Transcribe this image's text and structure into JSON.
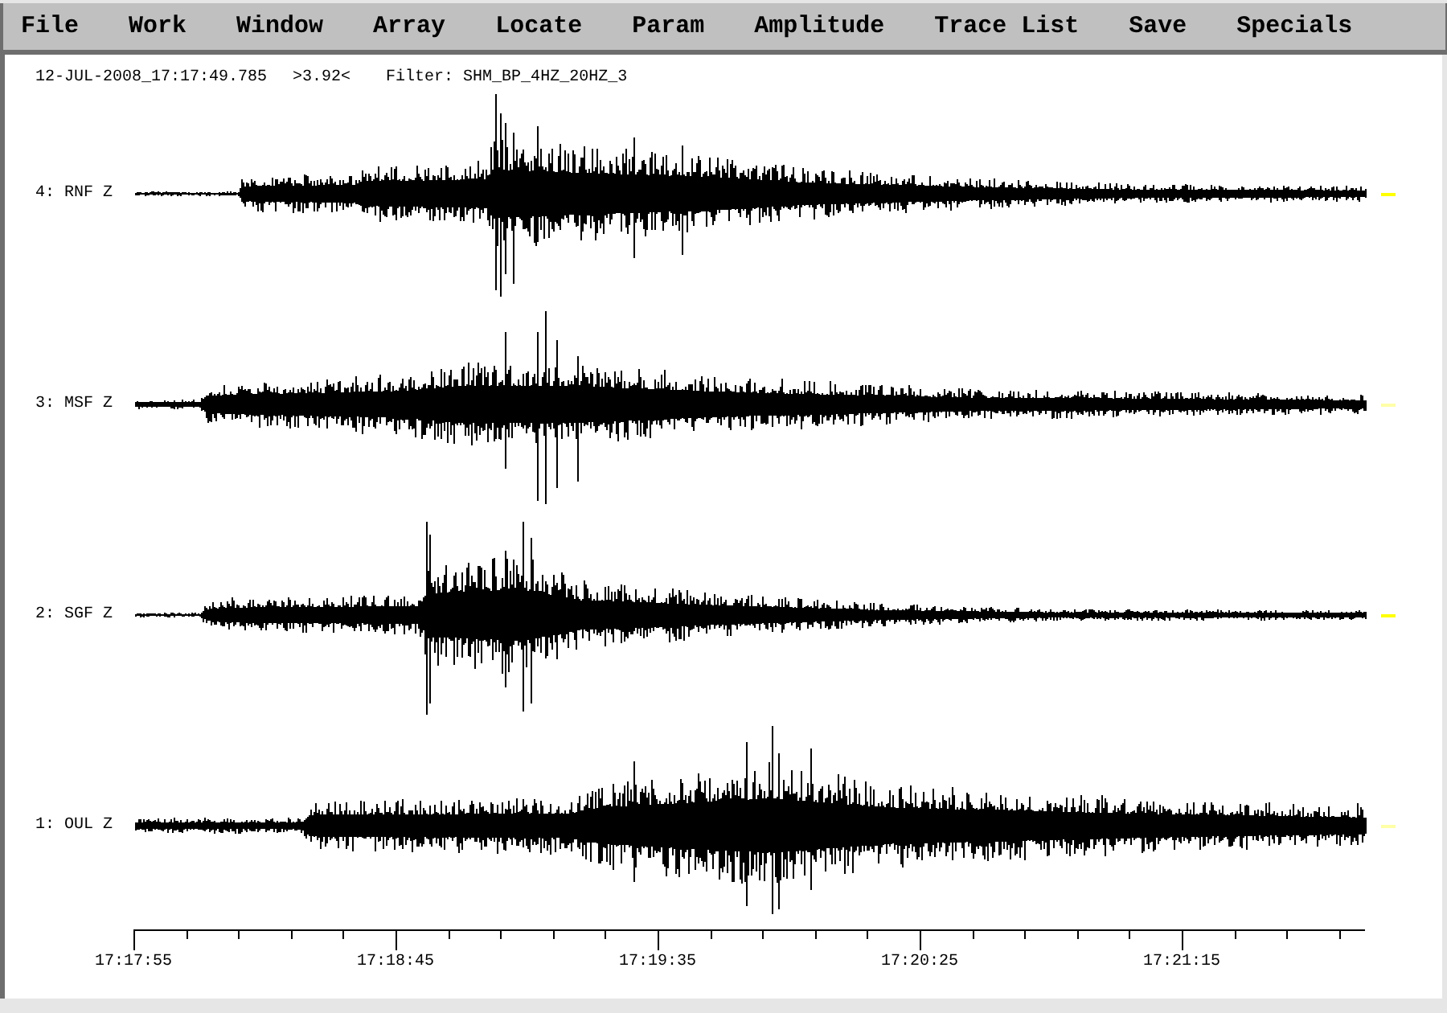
{
  "menu": [
    "File",
    "Work",
    "Window",
    "Array",
    "Locate",
    "Param",
    "Amplitude",
    "Trace List",
    "Save",
    "Specials"
  ],
  "header": {
    "timestamp": "12-JUL-2008_17:17:49.785",
    "amplitude_range": ">3.92<",
    "filter": "Filter: SHM_BP_4HZ_20HZ_3"
  },
  "traces": [
    {
      "label": "4: RNF Z",
      "color": "#ffff00"
    },
    {
      "label": "3: MSF Z",
      "color": "#ffffa8"
    },
    {
      "label": "2: SGF Z",
      "color": "#ffff00"
    },
    {
      "label": "1: OUL Z",
      "color": "#ffffa8"
    }
  ],
  "time_axis": {
    "ticks": [
      "17:17:55",
      "17:18:45",
      "17:19:35",
      "17:20:25",
      "17:21:15"
    ]
  }
}
